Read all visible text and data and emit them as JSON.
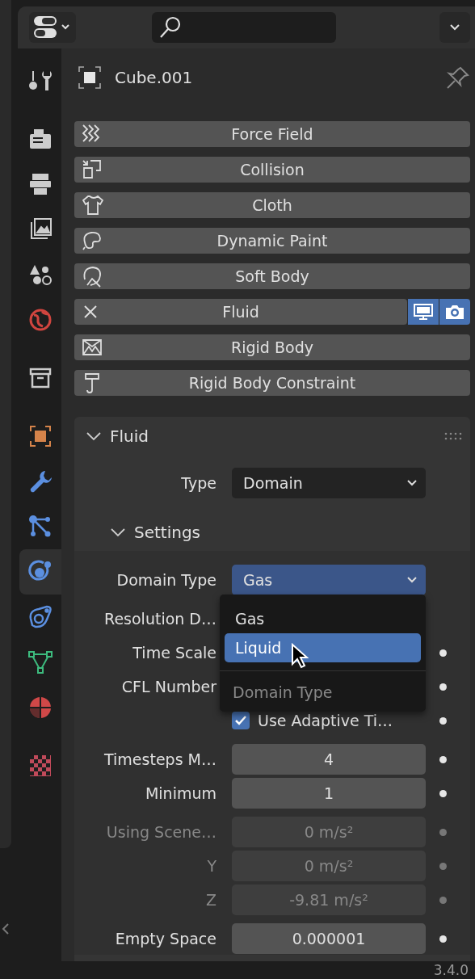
{
  "object": {
    "name": "Cube.001"
  },
  "tab_groups": [
    {
      "tabs": [
        {
          "kind": "tool",
          "selected": false,
          "color": "#cccccc"
        }
      ]
    },
    {
      "tabs": [
        {
          "kind": "render",
          "selected": false,
          "color": "#cccccc"
        },
        {
          "kind": "output",
          "selected": false,
          "color": "#cccccc"
        },
        {
          "kind": "view_layer",
          "selected": false,
          "color": "#cccccc"
        },
        {
          "kind": "scene",
          "selected": false,
          "color": "#cccccc"
        },
        {
          "kind": "world",
          "selected": false,
          "color": "#d0453f"
        }
      ]
    },
    {
      "tabs": [
        {
          "kind": "collection",
          "selected": false,
          "color": "#cccccc"
        }
      ]
    },
    {
      "tabs": [
        {
          "kind": "object",
          "selected": false,
          "color": "#d5834a"
        },
        {
          "kind": "modifiers",
          "selected": false,
          "color": "#5b8fe0"
        },
        {
          "kind": "particles",
          "selected": false,
          "color": "#5b8fe0"
        },
        {
          "kind": "physics",
          "selected": true,
          "color": "#5b8fe0"
        },
        {
          "kind": "constraints",
          "selected": false,
          "color": "#5b8fe0"
        },
        {
          "kind": "data",
          "selected": false,
          "color": "#3dbb7e"
        },
        {
          "kind": "material",
          "selected": false,
          "color": "#d04848"
        }
      ]
    },
    {
      "tabs": [
        {
          "kind": "texture",
          "selected": false,
          "color": "#c04a5a"
        }
      ]
    }
  ],
  "physics_buttons": [
    {
      "label": "Force Field",
      "kind": "force_field",
      "enabled": false
    },
    {
      "label": "Collision",
      "kind": "collision",
      "enabled": false
    },
    {
      "label": "Cloth",
      "kind": "cloth",
      "enabled": false
    },
    {
      "label": "Dynamic Paint",
      "kind": "dynamic_paint",
      "enabled": false
    },
    {
      "label": "Soft Body",
      "kind": "soft_body",
      "enabled": false
    },
    {
      "label": "Fluid",
      "enabled": true,
      "viewport": true,
      "render": true
    },
    {
      "label": "Rigid Body",
      "kind": "rigid_body",
      "enabled": false
    },
    {
      "label": "Rigid Body Constraint",
      "kind": "rigid_body_constraint",
      "enabled": false
    }
  ],
  "panel": {
    "title": "Fluid",
    "expanded": true,
    "type": {
      "label": "Type",
      "value": "Domain"
    },
    "settings": {
      "title": "Settings",
      "expanded": true,
      "groups": [
        {
          "rows": [
            {
              "kind": "dropdown",
              "label": "Domain Type",
              "value": "Gas",
              "open": true,
              "disabled": false
            }
          ]
        },
        {
          "rows": [
            {
              "kind": "covered",
              "label": "Resolution D…",
              "dot": false,
              "disabled": false
            },
            {
              "kind": "covered",
              "label": "Time Scale",
              "dot": true,
              "disabled": false
            },
            {
              "kind": "covered",
              "label": "CFL Number",
              "dot": true,
              "disabled": false
            },
            {
              "kind": "checkbox",
              "label": "Use Adaptive Ti…",
              "checked": true,
              "dot": true,
              "disabled": false
            }
          ]
        },
        {
          "rows": [
            {
              "kind": "number",
              "label": "Timesteps M…",
              "value": "4",
              "dot": true,
              "disabled": false
            },
            {
              "kind": "number",
              "label": "Minimum",
              "value": "1",
              "dot": true,
              "disabled": false
            }
          ]
        },
        {
          "rows": [
            {
              "kind": "number",
              "label": "Using Scene…",
              "value": "0 m/s²",
              "dot": true,
              "disabled": true
            },
            {
              "kind": "number",
              "label": "Y",
              "value": "0 m/s²",
              "dot": true,
              "disabled": true
            },
            {
              "kind": "number",
              "label": "Z",
              "value": "-9.81 m/s²",
              "dot": true,
              "disabled": true
            }
          ]
        },
        {
          "rows": [
            {
              "kind": "number",
              "label": "Empty Space",
              "value": "0.000001",
              "dot": true,
              "disabled": false
            }
          ]
        }
      ]
    }
  },
  "dropdown_menu": {
    "title": "Domain Type",
    "items": [
      {
        "label": "Gas",
        "selected": false
      },
      {
        "label": "Liquid",
        "selected": true
      }
    ]
  },
  "status_bar": {
    "version": "3.4.0"
  }
}
